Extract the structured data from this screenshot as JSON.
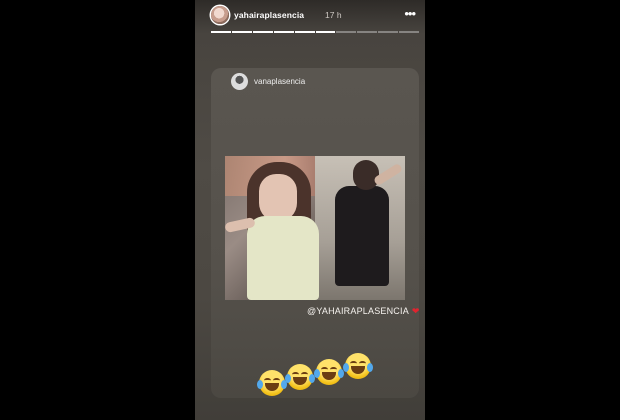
{
  "header": {
    "username": "yahairaplasencia",
    "time": "17 h",
    "more_icon": "more-horizontal-icon",
    "progress_total": 10,
    "progress_done": 6
  },
  "shared_post": {
    "username": "vanaplasencia",
    "mention_text": "@YAHAIRAPLASENCIA",
    "mention_emoji": "heart-icon",
    "emojis": [
      "laughing-tears-emoji",
      "laughing-tears-emoji",
      "laughing-tears-emoji",
      "laughing-tears-emoji"
    ]
  },
  "colors": {
    "heart": "#e0242f",
    "background": "#000000"
  }
}
